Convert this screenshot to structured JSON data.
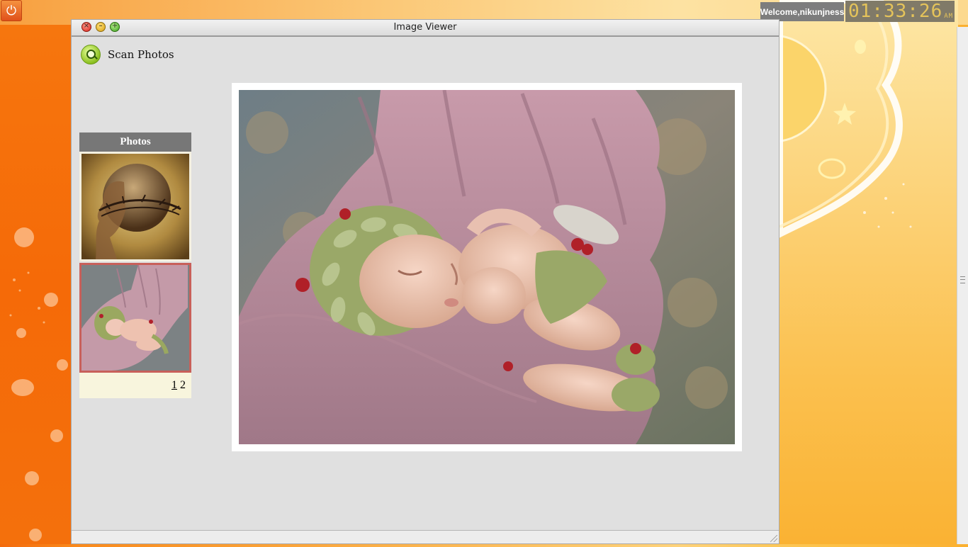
{
  "desktop": {
    "welcome_text": "Welcome,nikunjness",
    "clock_time": "01:33:26",
    "clock_ampm": "AM",
    "power_icon": "power-icon"
  },
  "window": {
    "title": "Image Viewer",
    "scan_button_label": "Scan Photos",
    "photos_header": "Photos",
    "thumbnails": [
      {
        "name": "thumbnail-head-globe",
        "selected": false
      },
      {
        "name": "thumbnail-sleeping-baby",
        "selected": true
      }
    ],
    "pager": {
      "pages": [
        "1",
        "2"
      ],
      "current": "1"
    }
  },
  "colors": {
    "selected_border": "#c8605a",
    "header_bg": "#777777",
    "pager_bg": "#f8f5dd"
  }
}
